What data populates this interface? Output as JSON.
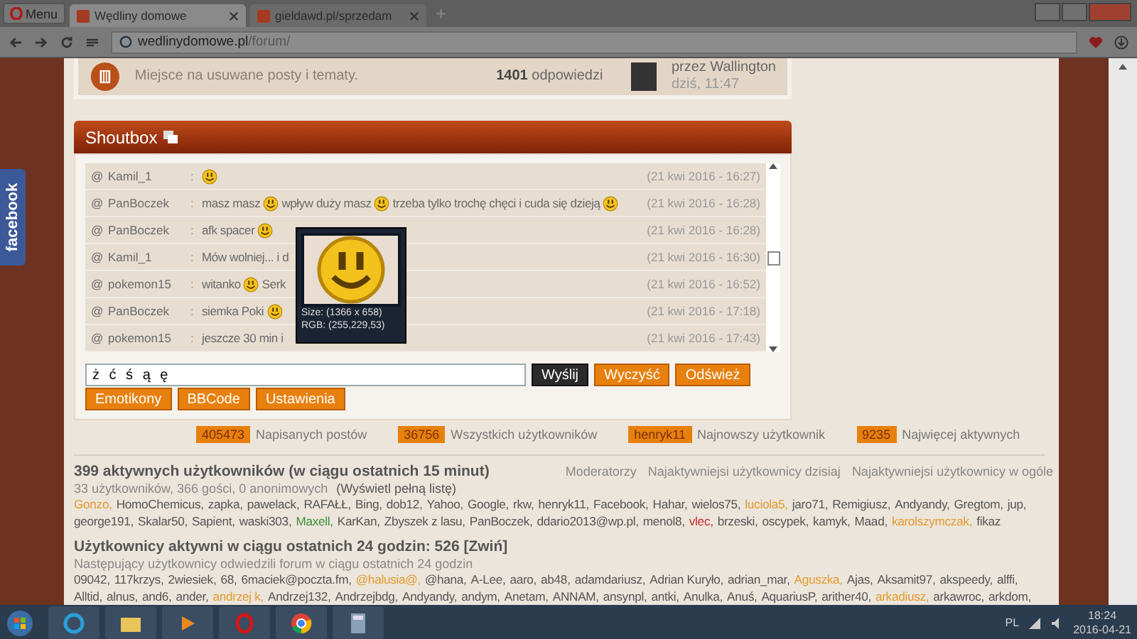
{
  "browser": {
    "menu": "Menu",
    "tabs": [
      {
        "title": "Wędliny domowe",
        "selected": true
      },
      {
        "title": "gieldawd.pl/sprzedam",
        "selected": false
      }
    ],
    "new_tab": "+",
    "url_host": "wedlinydomowe.pl",
    "url_path": "/forum/"
  },
  "side_tab": "facebook",
  "forum_row": {
    "description": "Miejsce na usuwane posty i tematy.",
    "replies_count": "1401",
    "replies_label": "odpowiedzi",
    "last_by": "przez Wallington",
    "last_time": "dziś, 11:47"
  },
  "shoutbox": {
    "title": "Shoutbox",
    "shouts": [
      {
        "at": "@",
        "user": "Kamil_1",
        "sep": ":",
        "parts": [
          {
            "kind": "smiley"
          }
        ],
        "time": "(21 kwi 2016 - 16:27)"
      },
      {
        "at": "@",
        "user": "PanBoczek",
        "sep": ":",
        "parts": [
          {
            "kind": "text",
            "text": "masz masz"
          },
          {
            "kind": "smiley"
          },
          {
            "kind": "text",
            "text": "wpływ duży masz"
          },
          {
            "kind": "smiley"
          },
          {
            "kind": "text",
            "text": "trzeba tylko trochę chęci i cuda się dzieją"
          },
          {
            "kind": "smiley"
          }
        ],
        "time": "(21 kwi 2016 - 16:28)"
      },
      {
        "at": "@",
        "user": "PanBoczek",
        "sep": ":",
        "parts": [
          {
            "kind": "text",
            "text": "afk spacer"
          },
          {
            "kind": "smiley"
          }
        ],
        "time": "(21 kwi 2016 - 16:28)"
      },
      {
        "at": "@",
        "user": "Kamil_1",
        "sep": ":",
        "parts": [
          {
            "kind": "text",
            "text": "Mów wolniej... i d"
          }
        ],
        "time": "(21 kwi 2016 - 16:30)"
      },
      {
        "at": "@",
        "user": "pokemon15",
        "sep": ":",
        "parts": [
          {
            "kind": "text",
            "text": "witanko"
          },
          {
            "kind": "smiley"
          },
          {
            "kind": "text",
            "text": "Serk"
          }
        ],
        "time": "(21 kwi 2016 - 16:52)"
      },
      {
        "at": "@",
        "user": "PanBoczek",
        "sep": ":",
        "parts": [
          {
            "kind": "text",
            "text": "siemka Poki"
          },
          {
            "kind": "smiley"
          }
        ],
        "time": "(21 kwi 2016 - 17:18)"
      },
      {
        "at": "@",
        "user": "pokemon15",
        "sep": ":",
        "parts": [
          {
            "kind": "text",
            "text": "jeszcze 30 min i"
          }
        ],
        "time": "(21 kwi 2016 - 17:43)"
      }
    ],
    "input_value": "ż ć ś ą ę",
    "send": "Wyślij",
    "actions": [
      "Wyczyść",
      "Odśwież"
    ],
    "tools": [
      "Emotikony",
      "BBCode",
      "Ustawienia"
    ]
  },
  "magnifier": {
    "size": "Size: (1366 x 658)",
    "rgb": "RGB: (255,229,53)"
  },
  "stats": [
    {
      "value": "405473",
      "label": "Napisanych postów"
    },
    {
      "value": "36756",
      "label": "Wszystkich użytkowników"
    },
    {
      "value": "henryk11",
      "label": "Najnowszy użytkownik"
    },
    {
      "value": "9235",
      "label": "Najwięcej aktywnych"
    }
  ],
  "online": {
    "title": "399 aktywnych użytkowników (w ciągu ostatnich 15 minut)",
    "links": [
      "Moderatorzy",
      "Najaktywniejsi użytkownicy dzisiaj",
      "Najaktywniejsi użytkownicy w ogóle"
    ],
    "subtitle": "33 użytkowników, 366 gości, 0 anonimowych",
    "show_all": "(Wyświetl pełną listę)",
    "user_lines": [
      [
        {
          "name": "Gonzo,",
          "color": "#e39a2e"
        },
        {
          "name": "HomoChemicus,",
          "color": "#555555"
        },
        {
          "name": "zapka,",
          "color": "#555555"
        },
        {
          "name": "pawelack,",
          "color": "#555555"
        },
        {
          "name": "RAFAŁŁ,",
          "color": "#555555"
        },
        {
          "name": "Bing,",
          "color": "#555555"
        },
        {
          "name": "dob12,",
          "color": "#555555"
        },
        {
          "name": "Yahoo,",
          "color": "#555555"
        },
        {
          "name": "Google,",
          "color": "#555555"
        },
        {
          "name": "rkw,",
          "color": "#555555"
        },
        {
          "name": "henryk11,",
          "color": "#555555"
        },
        {
          "name": "Facebook,",
          "color": "#555555"
        },
        {
          "name": "Hahar,",
          "color": "#555555"
        },
        {
          "name": "wielos75,",
          "color": "#555555"
        },
        {
          "name": "luciola5,",
          "color": "#e39a2e"
        },
        {
          "name": "jaro71,",
          "color": "#555555"
        },
        {
          "name": "Remigiusz,",
          "color": "#555555"
        },
        {
          "name": "Andyandy,",
          "color": "#555555"
        },
        {
          "name": "Gregtom,",
          "color": "#555555"
        },
        {
          "name": "jup,",
          "color": "#555555"
        }
      ],
      [
        {
          "name": "george191,",
          "color": "#555555"
        },
        {
          "name": "Skalar50,",
          "color": "#555555"
        },
        {
          "name": "Sapient,",
          "color": "#555555"
        },
        {
          "name": "waski303,",
          "color": "#555555"
        },
        {
          "name": "Maxell,",
          "color": "#3c8f3c"
        },
        {
          "name": "KarKan,",
          "color": "#555555"
        },
        {
          "name": "Zbyszek z lasu,",
          "color": "#555555"
        },
        {
          "name": "PanBoczek,",
          "color": "#555555"
        },
        {
          "name": "ddario2013@wp.pl,",
          "color": "#555555"
        },
        {
          "name": "menol8,",
          "color": "#555555"
        },
        {
          "name": "vlec,",
          "color": "#cc2a2a"
        },
        {
          "name": "brzeski,",
          "color": "#555555"
        },
        {
          "name": "oscypek,",
          "color": "#555555"
        },
        {
          "name": "kamyk,",
          "color": "#555555"
        },
        {
          "name": "Maad,",
          "color": "#555555"
        },
        {
          "name": "karolszymczak,",
          "color": "#e39a2e"
        },
        {
          "name": "fikaz",
          "color": "#555555"
        }
      ]
    ]
  },
  "daily": {
    "title": "Użytkownicy aktywni w ciągu ostatnich 24 godzin: 526 [Zwiń]",
    "subtitle": "Następujący użytkownicy odwiedzili forum w ciągu ostatnich 24 godzin",
    "user_lines": [
      [
        {
          "name": "09042,",
          "color": "#555555"
        },
        {
          "name": "117krzys,",
          "color": "#555555"
        },
        {
          "name": "2wiesiek,",
          "color": "#555555"
        },
        {
          "name": "68,",
          "color": "#555555"
        },
        {
          "name": "6maciek@poczta.fm,",
          "color": "#555555"
        },
        {
          "name": "@halusia@,",
          "color": "#e39a2e"
        },
        {
          "name": "@hana,",
          "color": "#555555"
        },
        {
          "name": "A-Lee,",
          "color": "#555555"
        },
        {
          "name": "aaro,",
          "color": "#555555"
        },
        {
          "name": "ab48,",
          "color": "#555555"
        },
        {
          "name": "adamdariusz,",
          "color": "#555555"
        },
        {
          "name": "Adrian Kuryło,",
          "color": "#555555"
        },
        {
          "name": "adrian_mar,",
          "color": "#555555"
        },
        {
          "name": "Aguszka,",
          "color": "#e39a2e"
        },
        {
          "name": "Ajas,",
          "color": "#555555"
        },
        {
          "name": "Aksamit97,",
          "color": "#555555"
        },
        {
          "name": "akspeedy,",
          "color": "#555555"
        },
        {
          "name": "alffi,",
          "color": "#555555"
        }
      ],
      [
        {
          "name": "Alltid,",
          "color": "#555555"
        },
        {
          "name": "alnus,",
          "color": "#555555"
        },
        {
          "name": "and6,",
          "color": "#555555"
        },
        {
          "name": "ander,",
          "color": "#555555"
        },
        {
          "name": "andrzej k,",
          "color": "#e39a2e"
        },
        {
          "name": "Andrzej132,",
          "color": "#555555"
        },
        {
          "name": "Andrzejbdg,",
          "color": "#555555"
        },
        {
          "name": "Andyandy,",
          "color": "#555555"
        },
        {
          "name": "andym,",
          "color": "#555555"
        },
        {
          "name": "Anetam,",
          "color": "#555555"
        },
        {
          "name": "ANNAM,",
          "color": "#555555"
        },
        {
          "name": "ansynpl,",
          "color": "#555555"
        },
        {
          "name": "antki,",
          "color": "#555555"
        },
        {
          "name": "Anulka,",
          "color": "#555555"
        },
        {
          "name": "Anuś,",
          "color": "#555555"
        },
        {
          "name": "AquariusP,",
          "color": "#555555"
        },
        {
          "name": "arither40,",
          "color": "#555555"
        },
        {
          "name": "arkadiusz,",
          "color": "#e39a2e"
        },
        {
          "name": "arkawroc,",
          "color": "#555555"
        },
        {
          "name": "arkdom,",
          "color": "#555555"
        }
      ]
    ]
  },
  "taskbar": {
    "language": "PL",
    "time": "18:24",
    "date": "2016-04-21"
  }
}
